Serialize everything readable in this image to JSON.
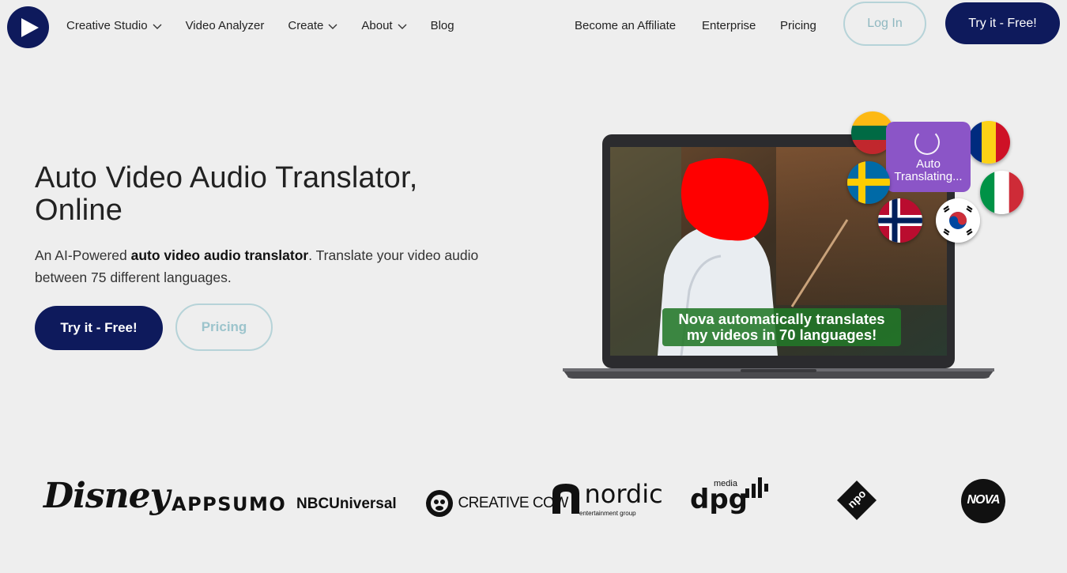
{
  "nav": {
    "logo_icon": "play-icon",
    "items_left": [
      {
        "label": "Creative Studio",
        "dropdown": true
      },
      {
        "label": "Video Analyzer",
        "dropdown": false
      },
      {
        "label": "Create",
        "dropdown": true
      },
      {
        "label": "About",
        "dropdown": true
      },
      {
        "label": "Blog",
        "dropdown": false
      }
    ],
    "items_right": [
      {
        "label": "Become an Affiliate"
      },
      {
        "label": "Enterprise"
      },
      {
        "label": "Pricing"
      }
    ],
    "login_label": "Log In",
    "try_label": "Try it - Free!"
  },
  "hero": {
    "title_line1": "Auto Video Audio Translator,",
    "title_line2": "Online",
    "desc_prefix": "An AI-Powered ",
    "desc_bold": "auto video audio translator",
    "desc_suffix": ". Translate your video audio between 75 different languages.",
    "try_label": "Try it - Free!",
    "pricing_label": "Pricing"
  },
  "media": {
    "caption_line1": "Nova automatically translates",
    "caption_line2": "my videos in 70 languages!",
    "status_line1": "Auto",
    "status_line2": "Translating...",
    "flags": [
      "lithuania",
      "romania",
      "sweden",
      "italy",
      "norway",
      "south-korea"
    ]
  },
  "logos": {
    "disney": "Disney",
    "appsumo": "APPSUMO",
    "nbcuniversal": "NBCUniversal",
    "creative_cow": "CREATIVE COW",
    "nordic": "nordic",
    "nordic_sub": "entertainment group",
    "dpg": "dpg",
    "dpg_sup": "media",
    "npo": "npo",
    "nova": "NOVA"
  },
  "colors": {
    "brand_navy": "#0e1a5c",
    "outline_teal": "#b6d3d8",
    "caption_green": "#227828",
    "status_purple": "#8b55c7"
  }
}
